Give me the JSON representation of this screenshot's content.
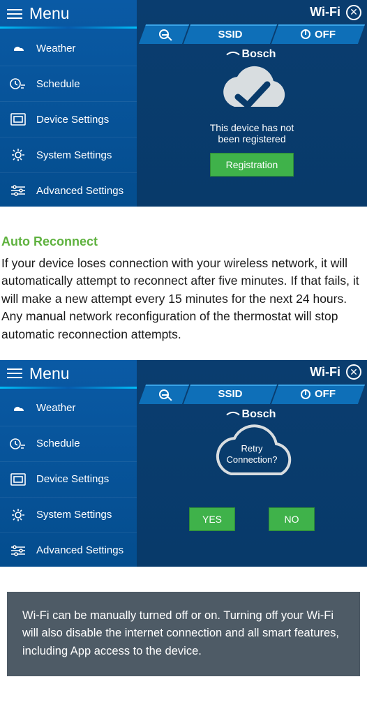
{
  "menu_label": "Menu",
  "wifi_title": "Wi-Fi",
  "sidebar_items": [
    {
      "label": "Weather",
      "icon": "weather"
    },
    {
      "label": "Schedule",
      "icon": "schedule"
    },
    {
      "label": "Device Settings",
      "icon": "device"
    },
    {
      "label": "System Settings",
      "icon": "system"
    },
    {
      "label": "Advanced Settings",
      "icon": "advanced"
    }
  ],
  "tabs": {
    "search": "",
    "ssid": "SSID",
    "off": "OFF"
  },
  "brand": "Bosch",
  "screen1": {
    "status_line1": "This device has not",
    "status_line2": "been registered",
    "button": "Registration"
  },
  "screen2": {
    "retry_line1": "Retry",
    "retry_line2": "Connection?",
    "yes": "YES",
    "no": "NO"
  },
  "doc": {
    "heading": "Auto Reconnect",
    "para": "If your device loses connection with your wireless network, it will automatically attempt to reconnect after five minutes. If that fails, it will make a new attempt every 15 minutes for the next 24 hours.  Any manual network reconfiguration of the thermostat will stop automatic reconnection attempts."
  },
  "note": "Wi-Fi can be manually turned off or on. Turning off your Wi-Fi will also disable the internet connection and all smart features, including App access to the device."
}
